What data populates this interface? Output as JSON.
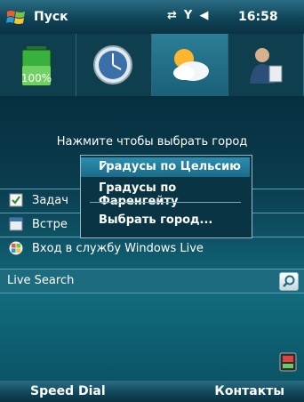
{
  "title_bar": {
    "start_label": "Пуск",
    "time": "16:58",
    "status_icons": [
      "connectivity-icon",
      "signal-off-icon",
      "volume-icon"
    ]
  },
  "tabs": [
    {
      "icon": "battery-icon",
      "label": "100%"
    },
    {
      "icon": "clock-icon"
    },
    {
      "icon": "weather-icon",
      "active": true
    },
    {
      "icon": "contacts-icon"
    }
  ],
  "today": {
    "hint": "Нажмите чтобы выбрать город",
    "items": [
      {
        "icon": "tasks-icon",
        "label": "Задач"
      },
      {
        "icon": "calendar-icon",
        "label": "Встре"
      },
      {
        "icon": "windows-live-icon",
        "label": "Вход в службу Windows Live"
      }
    ],
    "search_label": "Live Search"
  },
  "context_menu": {
    "items": [
      {
        "label": "Градусы по Цельсию",
        "checked": true
      },
      {
        "label": "Градусы по Фаренгейту",
        "checked": false
      },
      {
        "label": "Выбрать город...",
        "checked": false
      }
    ]
  },
  "softkeys": {
    "left": "Speed Dial",
    "right": "Контакты"
  },
  "colors": {
    "accent": "#1d6b7f",
    "menu_highlight": "#2a8fb0",
    "background": "#0d3b4b"
  }
}
